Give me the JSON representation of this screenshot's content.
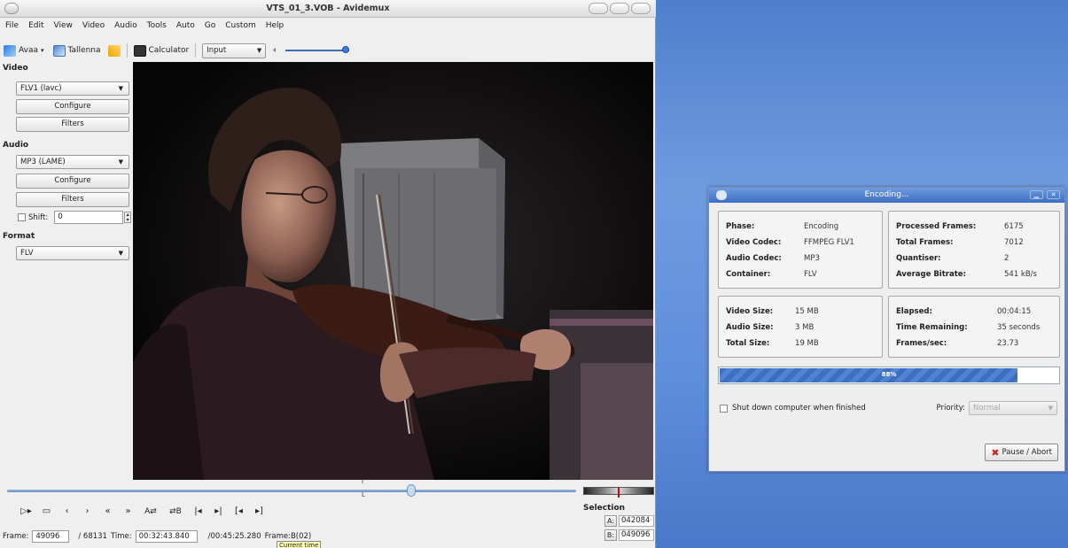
{
  "window": {
    "title": "VTS_01_3.VOB - Avidemux"
  },
  "menu": [
    "File",
    "Edit",
    "View",
    "Video",
    "Audio",
    "Tools",
    "Auto",
    "Go",
    "Custom",
    "Help"
  ],
  "toolbar": {
    "save_label": "Avaa",
    "save_as_label": "Tallenna",
    "calculator_label": "Calculator",
    "input_select": "Input",
    "volume_level": 0.95
  },
  "left_panel": {
    "video_label": "Video",
    "video_codec": "FLV1 (lavc)",
    "video_configure": "Configure",
    "video_filters": "Filters",
    "audio_label": "Audio",
    "audio_codec": "MP3 (LAME)",
    "audio_configure": "Configure",
    "audio_filters": "Filters",
    "shift_label": "Shift:",
    "shift_value": "0",
    "format_label": "Format",
    "format_value": "FLV"
  },
  "bottom": {
    "scrubber_position": 0.71,
    "frame_label": "Frame:",
    "frame_value": "49096",
    "total_frames": "/ 68131",
    "time_label": "Time:",
    "time_value": "00:32:43.840",
    "duration": "/00:45:25.280",
    "frame_type": "Frame:B(02)",
    "tooltip": "Current time",
    "selection_label": "Selection",
    "sel_a_btn": "A:",
    "sel_a_value": "042084",
    "sel_b_btn": "B:",
    "sel_b_value": "049096",
    "transport": [
      "▷▸",
      "▭",
      "‹",
      "›",
      "«",
      "»",
      "A⇄",
      "⇄B",
      "|◂",
      "▸|",
      "[◂",
      "▸]"
    ]
  },
  "dialog": {
    "title": "Encoding...",
    "info": {
      "phase_label": "Phase:",
      "phase": "Encoding",
      "video_codec_label": "Video Codec:",
      "video_codec": "FFMPEG FLV1",
      "audio_codec_label": "Audio Codec:",
      "audio_codec": "MP3",
      "container_label": "Container:",
      "container": "FLV"
    },
    "frames": {
      "processed_label": "Processed Frames:",
      "processed": "6175",
      "total_label": "Total Frames:",
      "total": "7012",
      "quantiser_label": "Quantiser:",
      "quantiser": "2",
      "bitrate_label": "Average Bitrate:",
      "bitrate": "541 kB/s"
    },
    "sizes": {
      "video_size_label": "Video Size:",
      "video_size": "15 MB",
      "audio_size_label": "Audio Size:",
      "audio_size": "3 MB",
      "total_size_label": "Total Size:",
      "total_size": "19 MB"
    },
    "time": {
      "elapsed_label": "Elapsed:",
      "elapsed": "00:04:15",
      "remaining_label": "Time Remaining:",
      "remaining": "35 seconds",
      "fps_label": "Frames/sec:",
      "fps": "23.73"
    },
    "progress_percent": 88,
    "progress_text": "88%",
    "shutdown_label": "Shut down computer when finished",
    "priority_label": "Priority:",
    "priority_value": "Normal",
    "abort_label": "Pause / Abort"
  }
}
